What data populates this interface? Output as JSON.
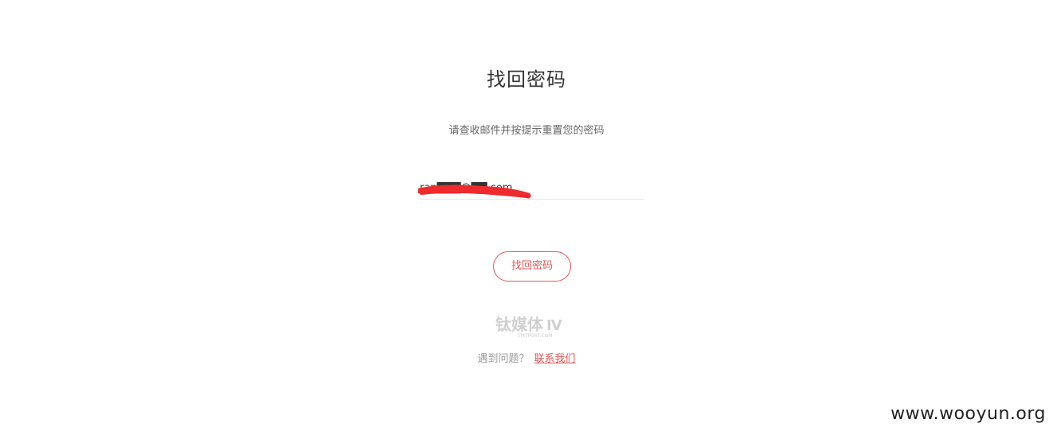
{
  "page": {
    "title": "找回密码",
    "subtitle": "请查收邮件并按提示重置您的密码"
  },
  "form": {
    "email_value": "ran███@██.com",
    "submit_label": "找回密码"
  },
  "logo": {
    "name": "钛媒体",
    "tagline": "TMTPOST.COM"
  },
  "help": {
    "question": "遇到问题？",
    "link_label": "联系我们"
  },
  "watermark": "www.wooyun.org",
  "colors": {
    "accent": "#e05a58",
    "redaction": "#ee2a2e"
  }
}
